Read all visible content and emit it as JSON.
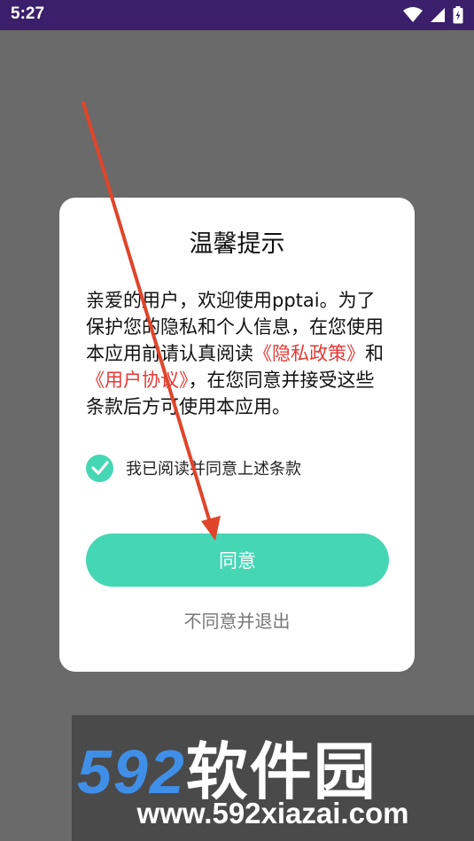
{
  "status_bar": {
    "time": "5:27",
    "icons": [
      "wifi-icon",
      "signal-icon",
      "battery-icon"
    ]
  },
  "dialog": {
    "title": "温馨提示",
    "body_pre": "亲爱的用户，欢迎使用pptai。为了保护您的隐私和个人信息，在您使用本应用前请认真阅读",
    "privacy_link": "《隐私政策》",
    "conjunction": "和",
    "agreement_link": "《用户协议》",
    "body_post": "，在您同意并接受这些条款后方可使用本应用。",
    "checkbox_checked": true,
    "checkbox_label": "我已阅读并同意上述条款",
    "agree_button": "同意",
    "decline_link": "不同意并退出"
  },
  "watermark": {
    "brand_num": "592",
    "brand_cn": "软件园",
    "url": "www.592xiazai.com"
  },
  "colors": {
    "accent": "#45d6b4",
    "link": "#e53935",
    "status_bar": "#3b1f6a",
    "arrow": "#e0452b"
  }
}
